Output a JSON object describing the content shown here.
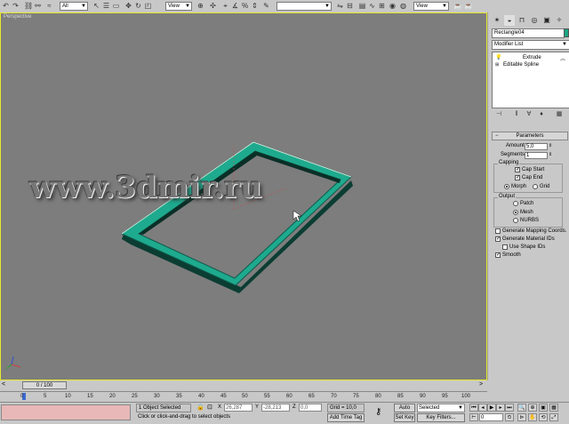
{
  "toolbar": {
    "selection_filter": "All",
    "ref_coord": "View",
    "ref_coord2": "View",
    "named_selection": ""
  },
  "viewport": {
    "label": "Perspective",
    "watermark": "www.3dmir.ru",
    "object_color": "#1aa383"
  },
  "panel": {
    "object_name": "Rectangle04",
    "modifier_list": "Modifier List",
    "stack": [
      "Extrude",
      "Editable Spline"
    ],
    "rollout": "Parameters",
    "amount_label": "Amount:",
    "amount_value": "5,0",
    "segments_label": "Segments:",
    "segments_value": "1",
    "capping_title": "Capping",
    "cap_start": "Cap Start",
    "cap_end": "Cap End",
    "morph": "Morph",
    "grid": "Grid",
    "output_title": "Output",
    "patch": "Patch",
    "mesh": "Mesh",
    "nurbs": "NURBS",
    "gen_mapping": "Generate Mapping Coords.",
    "gen_material": "Generate Material IDs",
    "use_shape": "Use Shape IDs",
    "smooth": "Smooth"
  },
  "timeline": {
    "slider": "0 / 100",
    "ticks": [
      "0",
      "5",
      "10",
      "15",
      "20",
      "25",
      "30",
      "35",
      "40",
      "45",
      "50",
      "55",
      "60",
      "65",
      "70",
      "75",
      "80",
      "85",
      "90",
      "95",
      "100"
    ]
  },
  "status": {
    "selected": "1 Object Selected",
    "prompt": "Click or click-and-drag to select objects",
    "x_label": "X",
    "x_value": "26,287",
    "y_label": "Y",
    "y_value": "-28,213",
    "z_label": "Z",
    "z_value": "0,0",
    "grid": "Grid = 10,0",
    "add_time_tag": "Add Time Tag",
    "auto_key": "Auto Key",
    "set_key": "Set Key",
    "selected_dd": "Selected",
    "key_filters": "Key Filters...",
    "frame": "0"
  }
}
